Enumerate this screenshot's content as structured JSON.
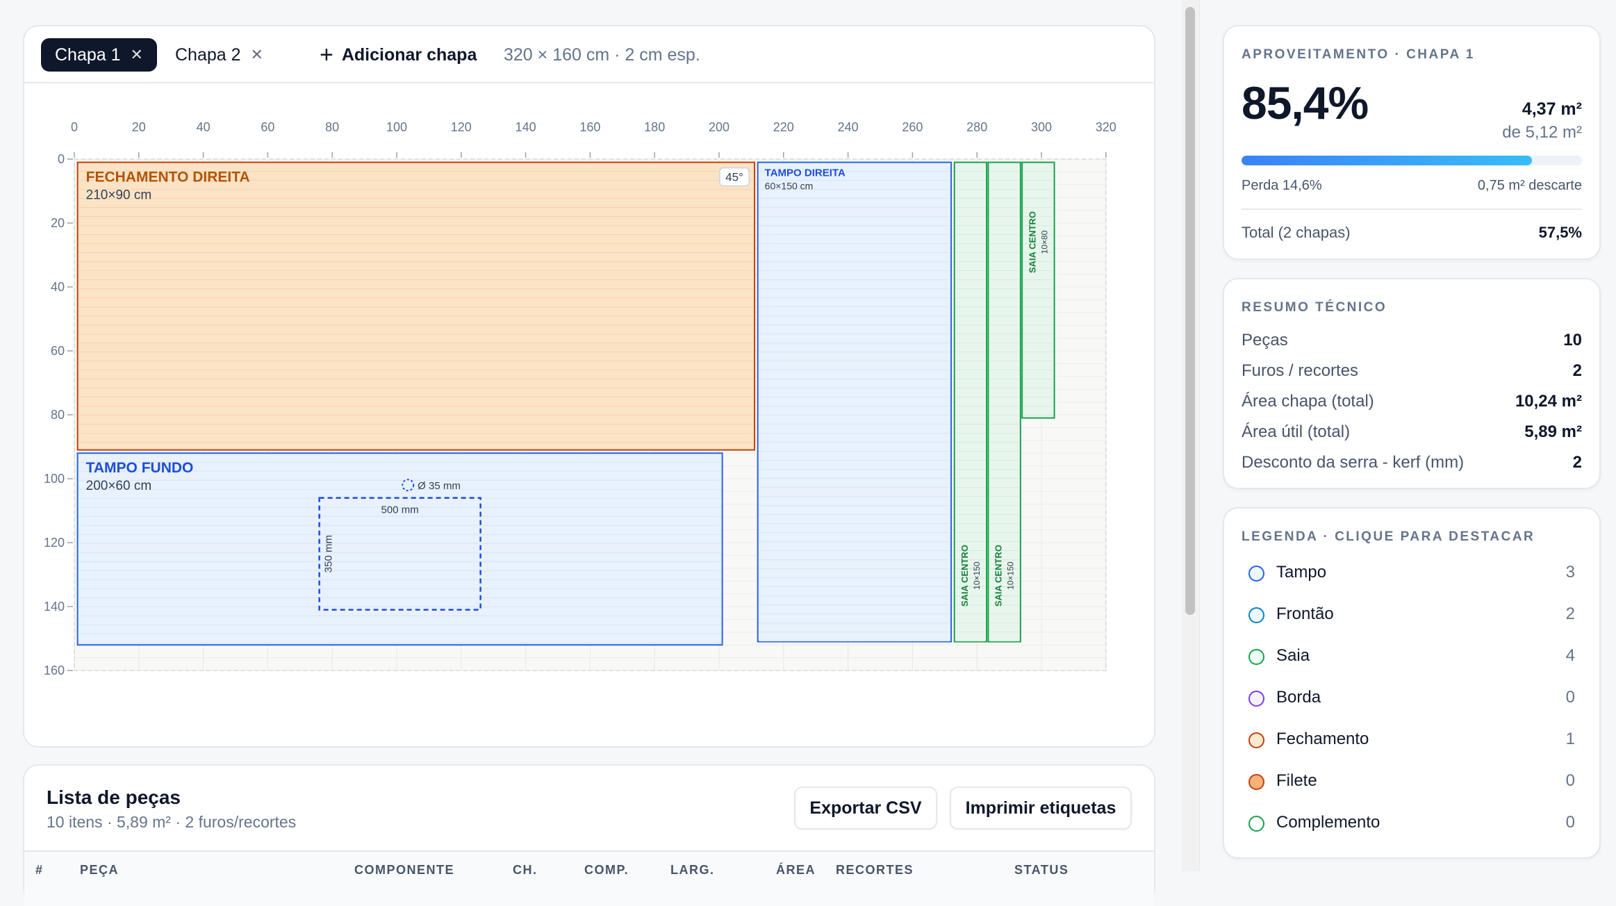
{
  "tabs": [
    {
      "label": "Chapa 1",
      "active": true
    },
    {
      "label": "Chapa 2",
      "active": false
    }
  ],
  "add_sheet_label": "Adicionar chapa",
  "sheet_meta": "320 × 160 cm · 2 cm esp.",
  "board": {
    "width_cm": 320,
    "height_cm": 160,
    "x_ticks": [
      "0",
      "20",
      "40",
      "60",
      "80",
      "100",
      "120",
      "140",
      "160",
      "180",
      "200",
      "220",
      "240",
      "260",
      "280",
      "300",
      "320"
    ],
    "y_ticks": [
      "0",
      "20",
      "40",
      "60",
      "80",
      "100",
      "120",
      "140",
      "160"
    ],
    "pieces": [
      {
        "name": "FECHAMENTO DIREITA",
        "dims": "210×90 cm",
        "x": 1,
        "y": 1,
        "w": 210,
        "h": 90,
        "kind": "fechamento",
        "badge": "45°"
      },
      {
        "name": "TAMPO FUNDO",
        "dims": "200×60 cm",
        "x": 1,
        "y": 92,
        "w": 200,
        "h": 60,
        "kind": "tampo",
        "badge": ""
      },
      {
        "name": "TAMPO DIREITA",
        "dims": "60×150 cm",
        "x": 212,
        "y": 1,
        "w": 60,
        "h": 150,
        "kind": "tampo-small",
        "badge": ""
      },
      {
        "name": "SAIA CENTRO",
        "dims": "10×150",
        "x": 273,
        "y": 1,
        "w": 10,
        "h": 150,
        "kind": "saia",
        "badge": ""
      },
      {
        "name": "SAIA CENTRO",
        "dims": "10×150",
        "x": 283.5,
        "y": 1,
        "w": 10,
        "h": 150,
        "kind": "saia",
        "badge": ""
      },
      {
        "name": "SAIA CENTRO",
        "dims": "10×80",
        "x": 294,
        "y": 1,
        "w": 10,
        "h": 80,
        "kind": "saia-top",
        "badge": ""
      }
    ],
    "hole_label": "Ø 35 mm",
    "cutout_width_label": "500 mm",
    "cutout_height_label": "350 mm"
  },
  "list": {
    "title": "Lista de peças",
    "subtitle": "10 itens · 5,89 m² · 2 furos/recortes",
    "export_label": "Exportar CSV",
    "print_label": "Imprimir etiquetas",
    "columns": [
      "#",
      "PEÇA",
      "COMPONENTE",
      "CH.",
      "COMP.",
      "LARG.",
      "ÁREA",
      "RECORTES",
      "STATUS"
    ]
  },
  "usage": {
    "heading": "APROVEITAMENTO · CHAPA 1",
    "percent": "85,4%",
    "area_used": "4,37 m²",
    "area_total": "de 5,12 m²",
    "fill": 0.854,
    "loss": "Perda 14,6%",
    "discard": "0,75 m² descarte",
    "total_label": "Total (2 chapas)",
    "total_value": "57,5%"
  },
  "summary": {
    "heading": "RESUMO TÉCNICO",
    "rows": [
      {
        "label": "Peças",
        "value": "10"
      },
      {
        "label": "Furos / recortes",
        "value": "2"
      },
      {
        "label": "Área chapa (total)",
        "value": "10,24 m²"
      },
      {
        "label": "Área útil (total)",
        "value": "5,89 m²"
      },
      {
        "label": "Desconto da serra - kerf (mm)",
        "value": "2"
      }
    ]
  },
  "legend": {
    "heading": "LEGENDA · CLIQUE PARA DESTACAR",
    "items": [
      {
        "name": "Tampo",
        "count": "3",
        "color": "#2563eb",
        "fill": "#eff6ff"
      },
      {
        "name": "Frontão",
        "count": "2",
        "color": "#0284c7",
        "fill": "#f0f9ff"
      },
      {
        "name": "Saia",
        "count": "4",
        "color": "#16a34a",
        "fill": "#f0fdf4"
      },
      {
        "name": "Borda",
        "count": "0",
        "color": "#7c3aed",
        "fill": "#f5f3ff"
      },
      {
        "name": "Fechamento",
        "count": "1",
        "color": "#c2410c",
        "fill": "#fde9d2"
      },
      {
        "name": "Filete",
        "count": "0",
        "color": "#c2410c",
        "fill": "#f5b27a"
      },
      {
        "name": "Complemento",
        "count": "0",
        "color": "#16a34a",
        "fill": "#ffffff"
      }
    ]
  }
}
